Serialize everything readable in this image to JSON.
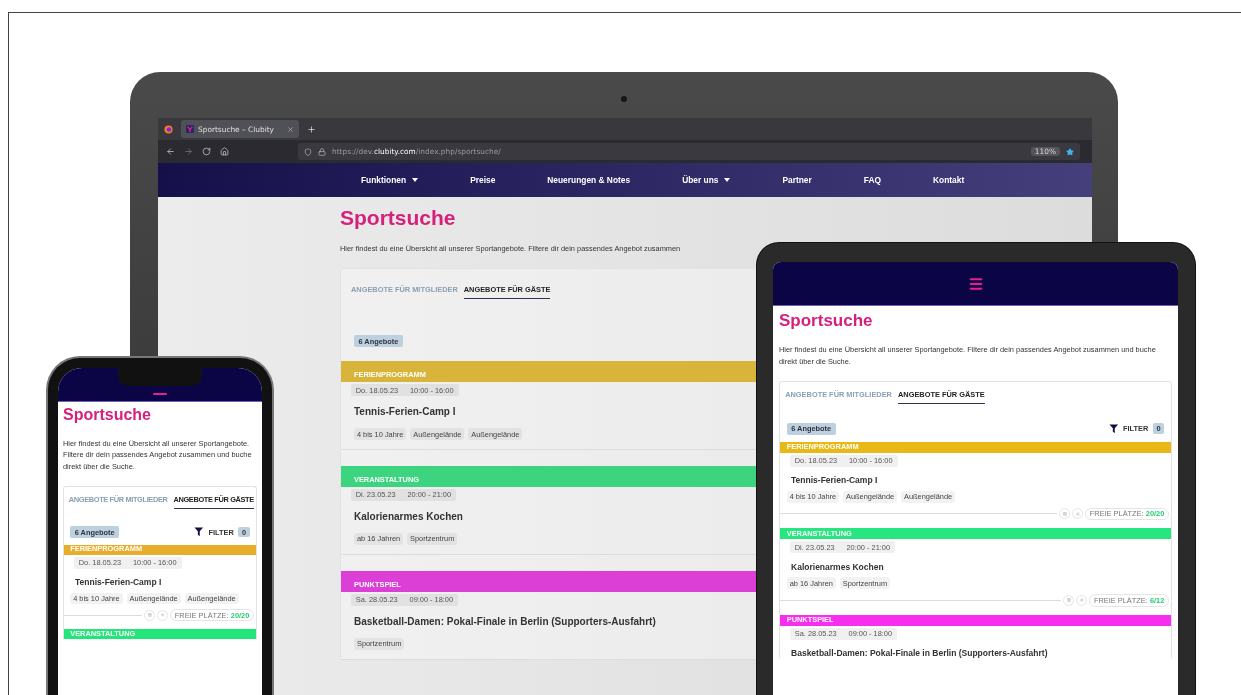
{
  "laptop": {
    "browser": {
      "tab_title": "Sportsuche – Clubity",
      "url": "https://dev.**clubity.com**/index.php/sportsuche/",
      "zoom": "110%"
    },
    "nav": [
      {
        "label": "Funktionen",
        "dropdown": true
      },
      {
        "label": "Preise",
        "dropdown": false
      },
      {
        "label": "Neuerungen & Notes",
        "dropdown": false
      },
      {
        "label": "Über uns",
        "dropdown": true
      },
      {
        "label": "Partner",
        "dropdown": false
      },
      {
        "label": "FAQ",
        "dropdown": false
      },
      {
        "label": "Kontakt",
        "dropdown": false
      }
    ],
    "page": {
      "title": "Sportsuche",
      "intro": "Hier findest du eine Übersicht all unserer Sportangebote. Filtere dir dein passendes Angebot zusammen",
      "tabs": [
        {
          "label": "ANGEBOTE FÜR MITGLIEDER",
          "selected": false
        },
        {
          "label": "ANGEBOTE FÜR GÄSTE",
          "selected": true
        }
      ],
      "count": "6 Angebote",
      "offers": [
        {
          "category": "FERIENPROGRAMM",
          "color": "#d8b43a",
          "date": "Do. 18.05.23",
          "time": "10:00 - 16:00",
          "name": "Tennis-Ferien-Camp I",
          "tags": [
            "4 bis 10 Jahre",
            "Außengelände",
            "Außengelände"
          ]
        },
        {
          "category": "VERANSTALTUNG",
          "color": "#3dd47f",
          "date": "Di. 23.05.23",
          "time": "20:00 - 21:00",
          "name": "Kalorienarmes Kochen",
          "tags": [
            "ab 16 Jahren",
            "Sportzentrum"
          ]
        },
        {
          "category": "PUNKTSPIEL",
          "color": "#dc3fd6",
          "date": "Sa. 28.05.23",
          "time": "09:00 - 18:00",
          "name": "Basketball-Damen: Pokal-Finale in Berlin (Supporters-Ausfahrt)",
          "tags": [
            "Sportzentrum"
          ]
        }
      ]
    }
  },
  "tablet": {
    "page": {
      "title": "Sportsuche",
      "intro": "Hier findest du eine Übersicht all unserer Sportangebote. Filtere dir dein passendes Angebot zusammen und buche direkt über die Suche.",
      "tabs": [
        {
          "label": "ANGEBOTE FÜR MITGLIEDER",
          "selected": false
        },
        {
          "label": "ANGEBOTE FÜR GÄSTE",
          "selected": true
        }
      ],
      "count": "6 Angebote",
      "filter": {
        "label": "FILTER",
        "count": "0"
      },
      "offers": [
        {
          "category": "FERIENPROGRAMM",
          "color": "#e8b816",
          "date": "Do. 18.05.23",
          "time": "10:00 - 16:00",
          "name": "Tennis-Ferien-Camp I",
          "tags": [
            "4 bis 10 Jahre",
            "Außengelände",
            "Außengelände"
          ],
          "slots": {
            "label": "FREIE PLÄTZE:",
            "value": "20/20"
          }
        },
        {
          "category": "VERANSTALTUNG",
          "color": "#27e57f",
          "date": "Di. 23.05.23",
          "time": "20:00 - 21:00",
          "name": "Kalorienarmes Kochen",
          "tags": [
            "ab 16 Jahren",
            "Sportzentrum"
          ],
          "slots": {
            "label": "FREIE PLÄTZE:",
            "value": "6/12"
          }
        },
        {
          "category": "PUNKTSPIEL",
          "color": "#f72ef0",
          "date": "Sa. 28.05.23",
          "time": "09:00 - 18:00",
          "name": "Basketball-Damen: Pokal-Finale in Berlin (Supporters-Ausfahrt)"
        }
      ]
    }
  },
  "phone": {
    "page": {
      "title": "Sportsuche",
      "intro": "Hier findest du eine Übersicht all unserer Sportangebote. Filtere dir dein passendes Angebot zusammen und buche direkt über die Suche.",
      "tabs": [
        {
          "label": "ANGEBOTE FÜR MITGLIEDER",
          "selected": false
        },
        {
          "label": "ANGEBOTE FÜR GÄSTE",
          "selected": true
        }
      ],
      "count": "6 Angebote",
      "filter": {
        "label": "FILTER",
        "count": "0"
      },
      "offers": [
        {
          "category": "FERIENPROGRAMM",
          "color": "#e9ad2c",
          "date": "Do. 18.05.23",
          "time": "10:00 - 16:00",
          "name": "Tennis-Ferien-Camp I",
          "tags": [
            "4 bis 10 Jahre",
            "Außengelände",
            "Außengelände"
          ],
          "slots": {
            "label": "FREIE PLÄTZE:",
            "value": "20/20"
          }
        },
        {
          "category": "VERANSTALTUNG",
          "color": "#22e67a"
        }
      ]
    }
  }
}
